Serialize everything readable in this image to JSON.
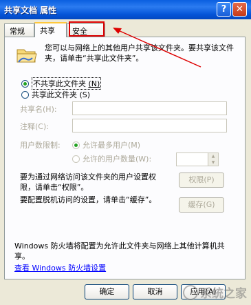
{
  "window": {
    "title": "共享文档 属性",
    "help_glyph": "?",
    "close_glyph": "✕"
  },
  "tabs": [
    {
      "label": "常规"
    },
    {
      "label": "共享"
    },
    {
      "label": "安全"
    }
  ],
  "share": {
    "intro": "您可以与网络上的其他用户共享该文件夹。要共享该文件夹，请单击“共享此文件夹”。",
    "radio_no_share": "不共享此文件夹",
    "radio_no_share_key": "(N)",
    "radio_share": "共享此文件夹",
    "radio_share_key": "(S)",
    "share_name_label": "共享名(H):",
    "comment_label": "注释(C):",
    "user_limit_label": "用户数限制:",
    "max_allowed_label": "允许最多用户(M)",
    "allow_this_many_label": "允许的用户数量(W):",
    "permissions_text": "要为通过网络访问该文件夹的用户设置权限，请单击“权限”。",
    "permissions_button": "权限(P)",
    "caching_text": "要配置脱机访问的设置，请单击“缓存”。",
    "caching_button": "缓存(G)",
    "firewall_text": "Windows 防火墙将配置为允许此文件夹与网络上其他计算机共享。",
    "firewall_link": "查看 Windows 防火墙设置"
  },
  "buttons": {
    "ok": "确定",
    "cancel": "取消",
    "apply": "应用(A)"
  },
  "watermark": "系统之家",
  "colors": {
    "annotation": "#dd0000",
    "title_bar": "#0454d8",
    "link": "#0000ff"
  }
}
